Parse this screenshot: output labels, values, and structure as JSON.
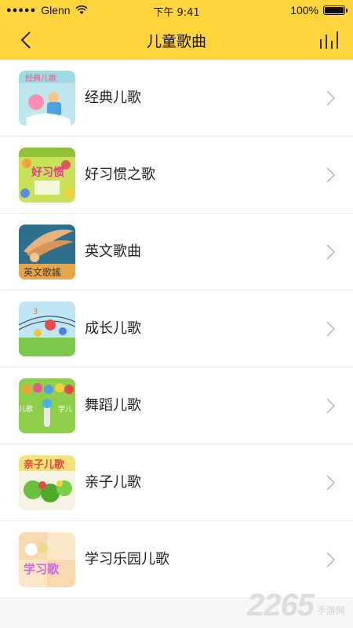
{
  "status_bar": {
    "carrier": "Glenn",
    "time": "下午 9:41",
    "battery": "100%"
  },
  "navbar": {
    "title": "儿童歌曲",
    "back_icon": "chevron-left-icon",
    "right_icon": "equalizer-bars-icon"
  },
  "items": [
    {
      "label": "经典儿歌"
    },
    {
      "label": "好习惯之歌"
    },
    {
      "label": "英文歌曲"
    },
    {
      "label": "成长儿歌"
    },
    {
      "label": "舞蹈儿歌"
    },
    {
      "label": "亲子儿歌"
    },
    {
      "label": "学习乐园儿歌"
    }
  ],
  "watermark": {
    "number": "2265",
    "text": "手游网"
  },
  "colors": {
    "accent": "#ffd43c"
  }
}
